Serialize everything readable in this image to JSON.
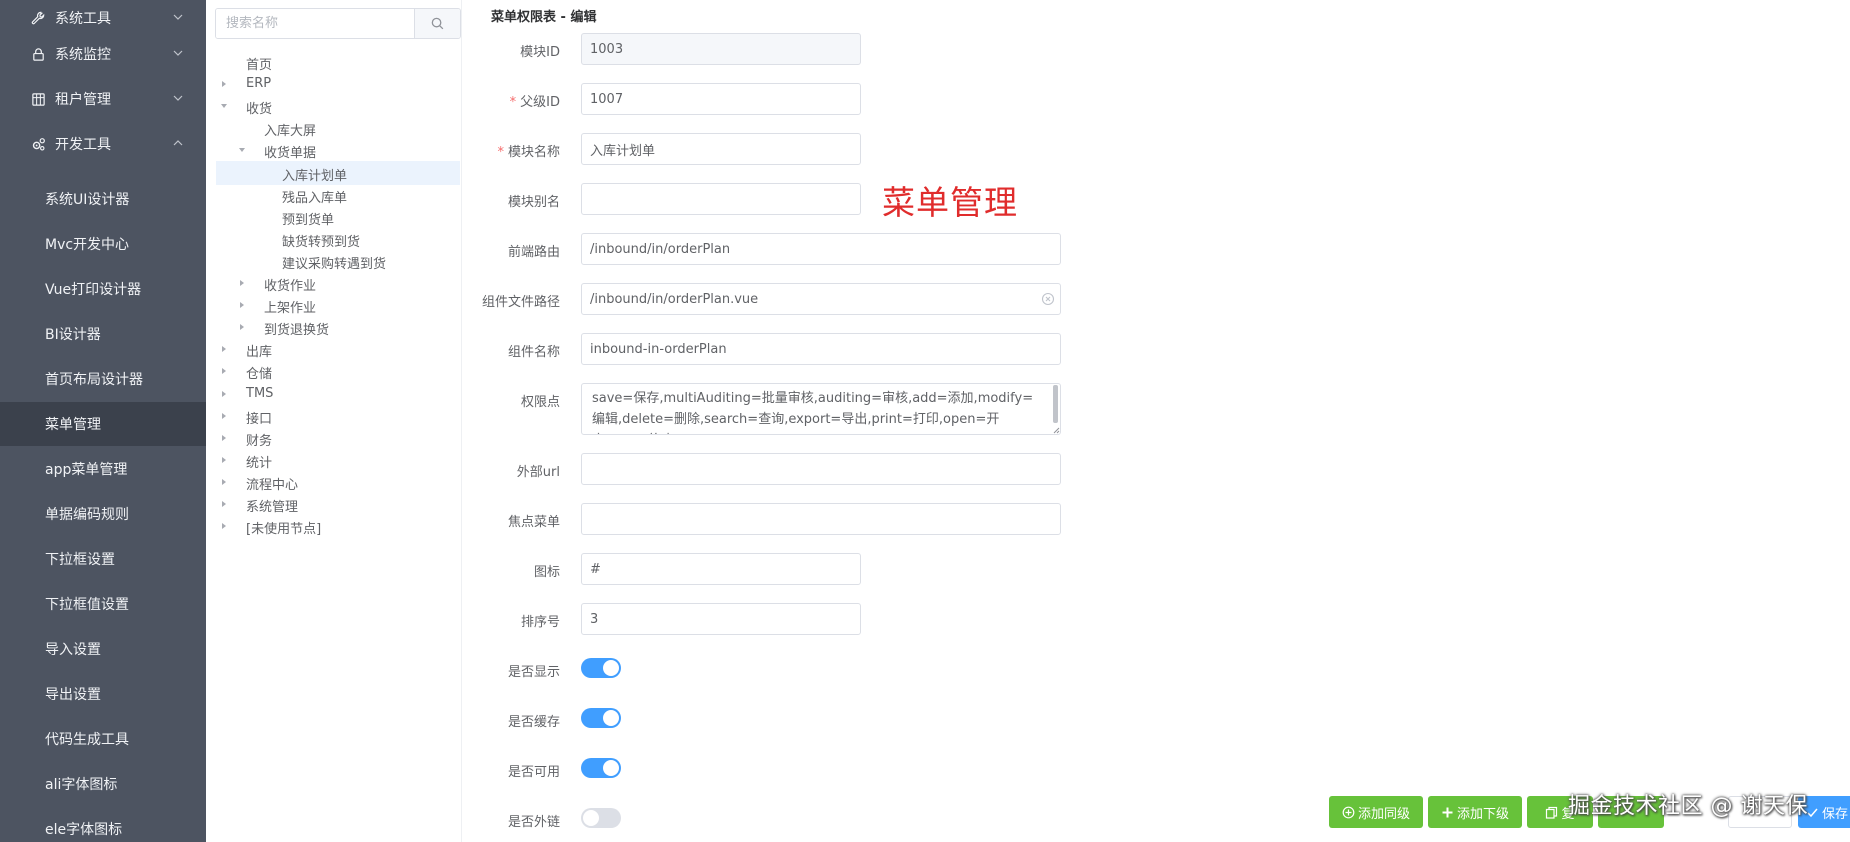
{
  "sidebar": {
    "groups": [
      {
        "label": "系统工具",
        "icon": "wrench-icon"
      },
      {
        "label": "系统监控",
        "icon": "lock-icon"
      },
      {
        "label": "租户管理",
        "icon": "grid-icon"
      },
      {
        "label": "开发工具",
        "icon": "cogs-icon"
      }
    ],
    "items": [
      {
        "label": "系统UI设计器"
      },
      {
        "label": "Mvc开发中心"
      },
      {
        "label": "Vue打印设计器"
      },
      {
        "label": "BI设计器"
      },
      {
        "label": "首页布局设计器"
      },
      {
        "label": "菜单管理",
        "active": true
      },
      {
        "label": "app菜单管理"
      },
      {
        "label": "单据编码规则"
      },
      {
        "label": "下拉框设置"
      },
      {
        "label": "下拉框值设置"
      },
      {
        "label": "导入设置"
      },
      {
        "label": "导出设置"
      },
      {
        "label": "代码生成工具"
      },
      {
        "label": "ali字体图标"
      },
      {
        "label": "ele字体图标"
      }
    ]
  },
  "tree": {
    "search_placeholder": "搜索名称",
    "nodes": [
      {
        "label": "首页",
        "caret": "none"
      },
      {
        "label": "ERP",
        "caret": "right"
      },
      {
        "label": "收货",
        "caret": "down"
      },
      {
        "label": "入库大屏",
        "caret": "none"
      },
      {
        "label": "收货单据",
        "caret": "down"
      },
      {
        "label": "入库计划单",
        "caret": "none",
        "selected": true
      },
      {
        "label": "残品入库单",
        "caret": "none"
      },
      {
        "label": "预到货单",
        "caret": "none"
      },
      {
        "label": "缺货转预到货",
        "caret": "none"
      },
      {
        "label": "建议采购转遇到货",
        "caret": "none"
      },
      {
        "label": "收货作业",
        "caret": "right"
      },
      {
        "label": "上架作业",
        "caret": "right"
      },
      {
        "label": "到货退换货",
        "caret": "right"
      },
      {
        "label": "出库",
        "caret": "right"
      },
      {
        "label": "仓储",
        "caret": "right"
      },
      {
        "label": "TMS",
        "caret": "right"
      },
      {
        "label": "接口",
        "caret": "right"
      },
      {
        "label": "财务",
        "caret": "right"
      },
      {
        "label": "统计",
        "caret": "right"
      },
      {
        "label": "流程中心",
        "caret": "right"
      },
      {
        "label": "系统管理",
        "caret": "right"
      },
      {
        "label": "[未使用节点]",
        "caret": "right"
      }
    ]
  },
  "form": {
    "title": "菜单权限表 - 编辑",
    "annotation": "菜单管理",
    "fields": {
      "module_id": {
        "label": "模块ID",
        "value": "1003"
      },
      "parent_id": {
        "label": "父级ID",
        "value": "1007",
        "required": true
      },
      "module_name": {
        "label": "模块名称",
        "value": "入库计划单",
        "required": true
      },
      "module_alias": {
        "label": "模块别名",
        "value": ""
      },
      "front_route": {
        "label": "前端路由",
        "value": "/inbound/in/orderPlan"
      },
      "component_path": {
        "label": "组件文件路径",
        "value": "/inbound/in/orderPlan.vue"
      },
      "component_name": {
        "label": "组件名称",
        "value": "inbound-in-orderPlan"
      },
      "permissions": {
        "label": "权限点",
        "value": "save=保存,multiAuditing=批量审核,auditing=审核,add=添加,modify=编辑,delete=删除,search=查询,export=导出,print=打印,open=开启,stop=终止"
      },
      "external_url": {
        "label": "外部url",
        "value": ""
      },
      "focus_menu": {
        "label": "焦点菜单",
        "value": ""
      },
      "icon": {
        "label": "图标",
        "value": "#"
      },
      "sort_order": {
        "label": "排序号",
        "value": "3"
      }
    },
    "switches": {
      "is_visible": {
        "label": "是否显示",
        "on": true
      },
      "is_cached": {
        "label": "是否缓存",
        "on": true
      },
      "is_enabled": {
        "label": "是否可用",
        "on": true
      },
      "is_external": {
        "label": "是否外链",
        "on": false
      }
    }
  },
  "buttons": {
    "add_sibling": "添加同级",
    "add_child": "添加下级",
    "copy": "复",
    "save": "保存"
  },
  "watermark": "掘金技术社区 @ 谢天保",
  "colors": {
    "sidebar_bg": "#4d5461",
    "sidebar_active": "#3b414c",
    "tree_selected": "#ebf3fd",
    "primary": "#409eff",
    "success": "#67c23a",
    "annotation": "#e02c2c"
  }
}
